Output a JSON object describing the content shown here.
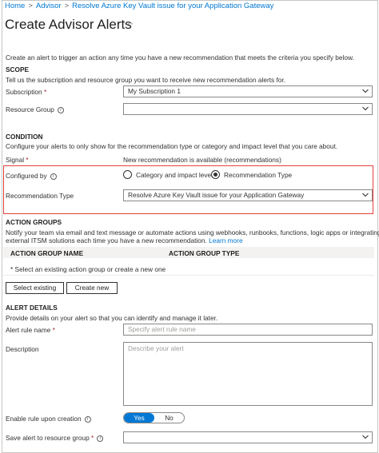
{
  "breadcrumb": [
    "Home",
    "Advisor",
    "Resolve Azure Key Vault issue for your Application Gateway"
  ],
  "page_title": "Create Advisor Alerts",
  "more_label": "···",
  "intro_text": "Create an alert to trigger an action any time you have a new recommendation that meets the criteria you specify below.",
  "scope": {
    "heading": "SCOPE",
    "description": "Tell us the subscription and resource group you want to receive new recommendation alerts for.",
    "subscription_label": "Subscription",
    "subscription_required": "*",
    "subscription_value": "My Subscription 1",
    "resource_group_label": "Resource Group",
    "resource_group_value": ""
  },
  "condition": {
    "heading": "CONDITION",
    "description": "Configure your alerts to only show for the recommendation type or category and impact level that you care about.",
    "signal_label": "Signal",
    "signal_required": "*",
    "signal_value": "New recommendation is available (recommendations)",
    "configured_by_label": "Configured by",
    "option_category": "Category and impact level",
    "option_type": "Recommendation Type",
    "selected_option": "Recommendation Type",
    "recommendation_type_label": "Recommendation Type",
    "recommendation_type_value": "Resolve Azure Key Vault issue for your Application Gateway"
  },
  "action_groups": {
    "heading": "ACTION GROUPS",
    "description_line1": "Notify your team via email and text message or automate actions using webhooks, runbooks, functions, logic apps or integrating with",
    "description_line2": "external ITSM solutions each time you have a new recommendation.",
    "learn_more": "Learn more",
    "col_name": "ACTION GROUP NAME",
    "col_type": "ACTION GROUP TYPE",
    "empty_text": "* Select an existing action group or create a new one",
    "select_button": "Select existing",
    "create_button": "Create new"
  },
  "alert_details": {
    "heading": "ALERT DETAILS",
    "description": "Provide details on your alert so that you can identify and manage it later.",
    "rule_name_label": "Alert rule name",
    "rule_name_required": "*",
    "rule_name_placeholder": "Specify alert rule name",
    "description_label": "Description",
    "description_placeholder": "Describe your alert",
    "enable_label": "Enable rule upon creation",
    "toggle_yes": "Yes",
    "toggle_no": "No",
    "save_rg_label": "Save alert to resource group",
    "save_rg_required": "*",
    "save_rg_value": ""
  },
  "colors": {
    "accent": "#0078d4",
    "highlight_border": "#e3413c",
    "required": "#a4262c"
  },
  "icons": [
    "chevron-down-icon",
    "info-icon",
    "more-icon"
  ]
}
